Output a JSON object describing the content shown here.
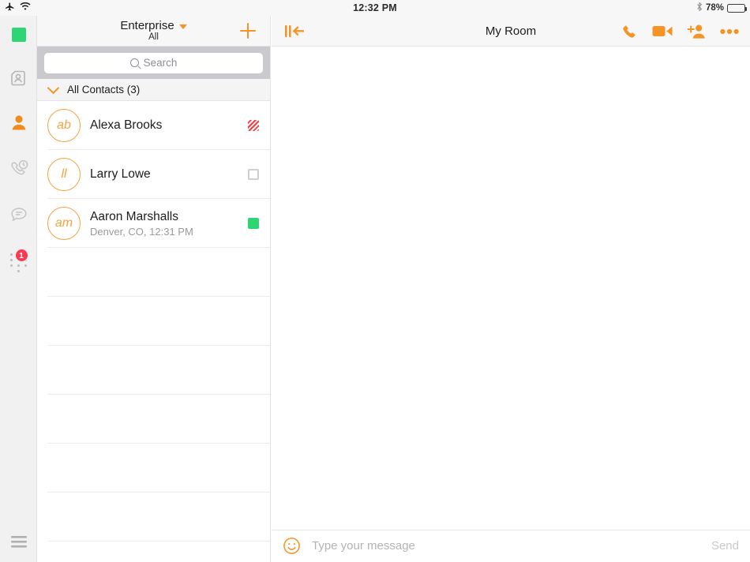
{
  "statusbar": {
    "airplane_icon": "airplane-icon",
    "wifi_icon": "wifi-icon",
    "time": "12:32 PM",
    "bluetooth_icon": "bluetooth-icon",
    "battery_percent": "78%",
    "battery_level": 78
  },
  "rail": {
    "items": [
      {
        "name": "presence-status",
        "icon": "green-square-icon",
        "active": false
      },
      {
        "name": "directory",
        "icon": "contact-card-icon",
        "active": false
      },
      {
        "name": "contacts",
        "icon": "person-icon",
        "active": true
      },
      {
        "name": "call-history",
        "icon": "phone-clock-icon",
        "active": false
      },
      {
        "name": "chat",
        "icon": "chat-bubble-icon",
        "active": false
      },
      {
        "name": "dialpad",
        "icon": "dialpad-icon",
        "active": false,
        "badge": "1"
      }
    ],
    "menu_icon": "hamburger-menu-icon"
  },
  "sidebar": {
    "directory_title": "Enterprise",
    "directory_filter": "All",
    "dropdown_icon": "caret-down-icon",
    "add_icon": "plus-icon",
    "search": {
      "placeholder": "Search",
      "icon": "search-icon",
      "value": ""
    },
    "group": {
      "label": "All Contacts (3)",
      "chevron_icon": "chevron-down-icon",
      "expanded": true
    },
    "contacts": [
      {
        "name": "Alexa Brooks",
        "initials": "ab",
        "subtitle": "",
        "status": "busy",
        "status_icon": "busy-status-icon"
      },
      {
        "name": "Larry Lowe",
        "initials": "ll",
        "subtitle": "",
        "status": "offline",
        "status_icon": "offline-status-icon"
      },
      {
        "name": "Aaron Marshalls",
        "initials": "am",
        "subtitle": "Denver, CO, 12:31 PM",
        "status": "available",
        "status_icon": "available-status-icon"
      }
    ],
    "empty_row_count": 6
  },
  "panel": {
    "collapse_icon": "collapse-panel-icon",
    "title": "My Room",
    "actions": [
      {
        "name": "audio-call",
        "icon": "phone-icon"
      },
      {
        "name": "video-call",
        "icon": "video-camera-icon"
      },
      {
        "name": "add-participant",
        "icon": "add-person-icon"
      },
      {
        "name": "more-options",
        "icon": "ellipsis-icon"
      }
    ],
    "composer": {
      "emoji_icon": "smiley-icon",
      "placeholder": "Type your message",
      "value": "",
      "send_label": "Send"
    }
  },
  "colors": {
    "accent": "#f59426",
    "available": "#2ed573",
    "busy": "#fb3b40",
    "badge": "#fa3a52"
  }
}
